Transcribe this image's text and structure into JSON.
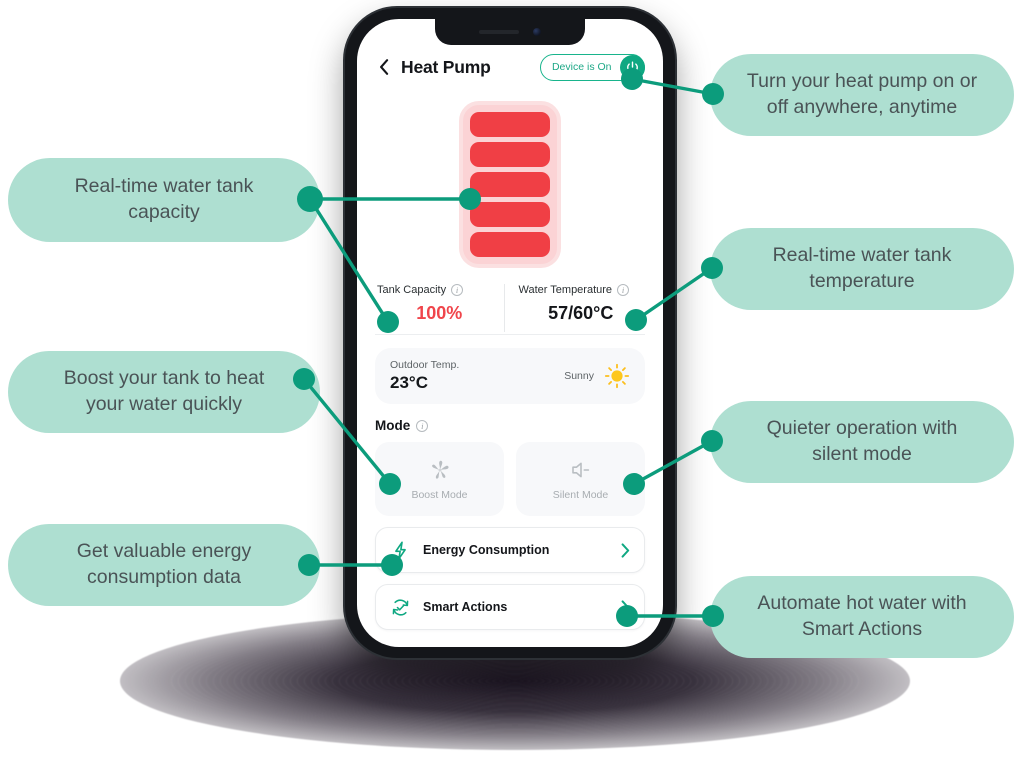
{
  "theme": {
    "accent": "#0fa882",
    "callout_bg": "#aedfd1",
    "callout_text": "#4a5356",
    "tank_fill": "#f03f45",
    "tank_shell": "#fbd3d5",
    "capacity_text": "#f0454b",
    "phone_body": "#14161a"
  },
  "phone": {
    "status_icons": {
      "speaker": "speaker-grille-icon",
      "camera": "front-camera-icon"
    }
  },
  "app": {
    "appbar": {
      "back_icon": "chevron-left-icon",
      "title": "Heat Pump",
      "toggle_label": "Device is On",
      "power_icon": "power-icon"
    },
    "tank": {
      "segment_count": 5,
      "fill_percent": 100
    },
    "metrics": [
      {
        "label": "Tank Capacity",
        "value": "100%",
        "info_icon": "info-icon",
        "value_kind": "capacity"
      },
      {
        "label": "Water Temperature",
        "value": "57/60°C",
        "info_icon": "info-icon",
        "value_kind": "temperature"
      }
    ],
    "outdoor": {
      "label": "Outdoor Temp.",
      "value": "23°C",
      "weather_label": "Sunny",
      "weather_icon": "sun-icon"
    },
    "mode": {
      "title": "Mode",
      "info_icon": "info-icon",
      "cards": [
        {
          "label": "Boost Mode",
          "icon": "fan-icon"
        },
        {
          "label": "Silent Mode",
          "icon": "speaker-mute-icon"
        }
      ]
    },
    "rows": [
      {
        "label": "Energy Consumption",
        "icon": "lightning-bolt-icon",
        "chevron": "chevron-right-icon"
      },
      {
        "label": "Smart Actions",
        "icon": "refresh-check-icon",
        "chevron": "chevron-right-icon"
      }
    ]
  },
  "callouts": [
    {
      "id": "power",
      "lines": [
        "Turn your heat pump on or",
        "off anywhere, anytime"
      ]
    },
    {
      "id": "capacity",
      "lines": [
        "Real-time water tank",
        "capacity"
      ]
    },
    {
      "id": "temperature",
      "lines": [
        "Real-time water tank",
        "temperature"
      ]
    },
    {
      "id": "boost",
      "lines": [
        "Boost your tank to heat",
        "your water quickly"
      ]
    },
    {
      "id": "silent",
      "lines": [
        "Quieter operation with",
        "silent mode"
      ]
    },
    {
      "id": "energy",
      "lines": [
        "Get valuable energy",
        "consumption data"
      ]
    },
    {
      "id": "smart",
      "lines": [
        "Automate hot water with",
        "Smart Actions"
      ]
    }
  ]
}
